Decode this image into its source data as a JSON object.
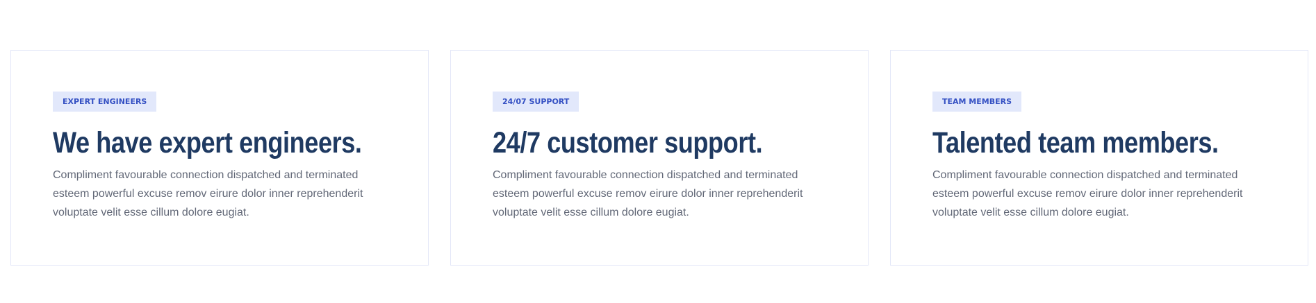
{
  "features": {
    "cards": [
      {
        "tag": "EXPERT ENGINEERS",
        "title": "We have expert engineers.",
        "text": "Compliment favourable connection dispatched and terminated esteem powerful excuse remov eirure dolor inner reprehenderit voluptate velit esse cillum dolore eugiat."
      },
      {
        "tag": "24/07 SUPPORT",
        "title": "24/7 customer support.",
        "text": "Compliment favourable connection dispatched and terminated esteem powerful excuse remov eirure dolor inner reprehenderit voluptate velit esse cillum dolore eugiat."
      },
      {
        "tag": "TEAM MEMBERS",
        "title": "Talented team members.",
        "text": "Compliment favourable connection dispatched and terminated esteem powerful excuse remov eirure dolor inner reprehenderit voluptate velit esse cillum dolore eugiat."
      }
    ]
  },
  "colors": {
    "tag_background": "#e2e8fb",
    "tag_text": "#3450c3",
    "title": "#1f3a62",
    "body_text": "#626877",
    "card_border": "#e3e7f8"
  }
}
